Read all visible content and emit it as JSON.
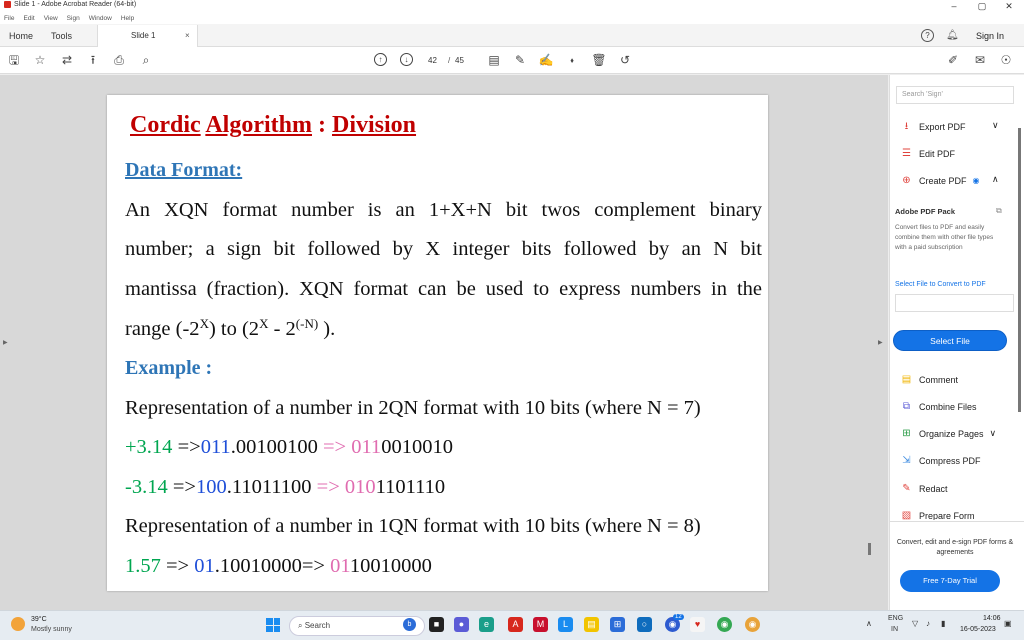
{
  "window": {
    "title": "Slide 1 - Adobe Acrobat Reader (64-bit)",
    "minimize": "–",
    "maximize": "▢",
    "close": "✕"
  },
  "menu": [
    "File",
    "Edit",
    "View",
    "Sign",
    "Window",
    "Help"
  ],
  "tabs": {
    "home": "Home",
    "tools": "Tools",
    "doc": "Slide 1",
    "close": "×",
    "help": "?",
    "signin": "Sign In"
  },
  "toolbar": {
    "page_current": "42",
    "page_sep": "/",
    "page_total": "45"
  },
  "slide": {
    "title_part1": "Cordic",
    "title_part2": "Algorithm",
    "title_colon": " : ",
    "title_part3": "Division",
    "heading_format": "Data Format:",
    "para_line1": "An XQN format number is an 1+X+N bit twos complement binary",
    "para_line2": "number; a sign bit followed by X integer bits followed by an N bit",
    "para_line3": "mantissa (fraction). XQN format can be used to express numbers in the",
    "range_a": "range (-2",
    "range_sup1": "X",
    "range_b": ") to (2",
    "range_sup2": "X",
    "range_c": " - 2",
    "range_sup3": "(-N)",
    "range_d": " ).",
    "heading_example": "Example :",
    "rep1": "Representation of a number in 2QN format with 10 bits (where N = 7)",
    "ex1": {
      "num": "+3.14",
      "arrow1": " =>",
      "sign": "011",
      "frac": ".00100100",
      "arrow2": " => ",
      "b1": "011",
      "b2": "0010010"
    },
    "ex2": {
      "num": "-3.14",
      "arrow1": " =>",
      "sign": "100",
      "frac": ".11011100",
      "arrow2": " => ",
      "b1": "010",
      "b2": "1101110"
    },
    "rep2": "Representation of a number in 1QN format with 10 bits (where N = 8)",
    "ex3": {
      "num": "1.57",
      "arrow1": " => ",
      "sign": "01",
      "frac": ".10010000",
      "arrow2": "=> ",
      "b1": "01",
      "b2": "10010000"
    }
  },
  "right_panel": {
    "search_placeholder": "Search 'Sign'",
    "export_pdf": "Export PDF",
    "edit_pdf": "Edit PDF",
    "create_pdf": "Create PDF",
    "pack_title": "Adobe PDF Pack",
    "pack_desc": "Convert files to PDF and easily combine them with other file types with a paid subscription",
    "select_link": "Select File to Convert to PDF",
    "select_button": "Select File",
    "comment": "Comment",
    "combine": "Combine Files",
    "organize": "Organize Pages",
    "compress": "Compress PDF",
    "redact": "Redact",
    "prepare": "Prepare Form",
    "promo": "Convert, edit and e-sign PDF forms & agreements",
    "trial_button": "Free 7-Day Trial"
  },
  "taskbar": {
    "temp": "39°C",
    "weather": "Mostly sunny",
    "search": "Search",
    "badge_count": "12",
    "lang1": "ENG",
    "lang2": "IN",
    "time": "14:06",
    "date": "16-05-2023"
  },
  "colors": {
    "title_red": "#c00000",
    "heading_blue": "#2e75b6",
    "green": "#00a650",
    "pink": "#e06cb0",
    "acrobat_blue": "#1473e6"
  }
}
